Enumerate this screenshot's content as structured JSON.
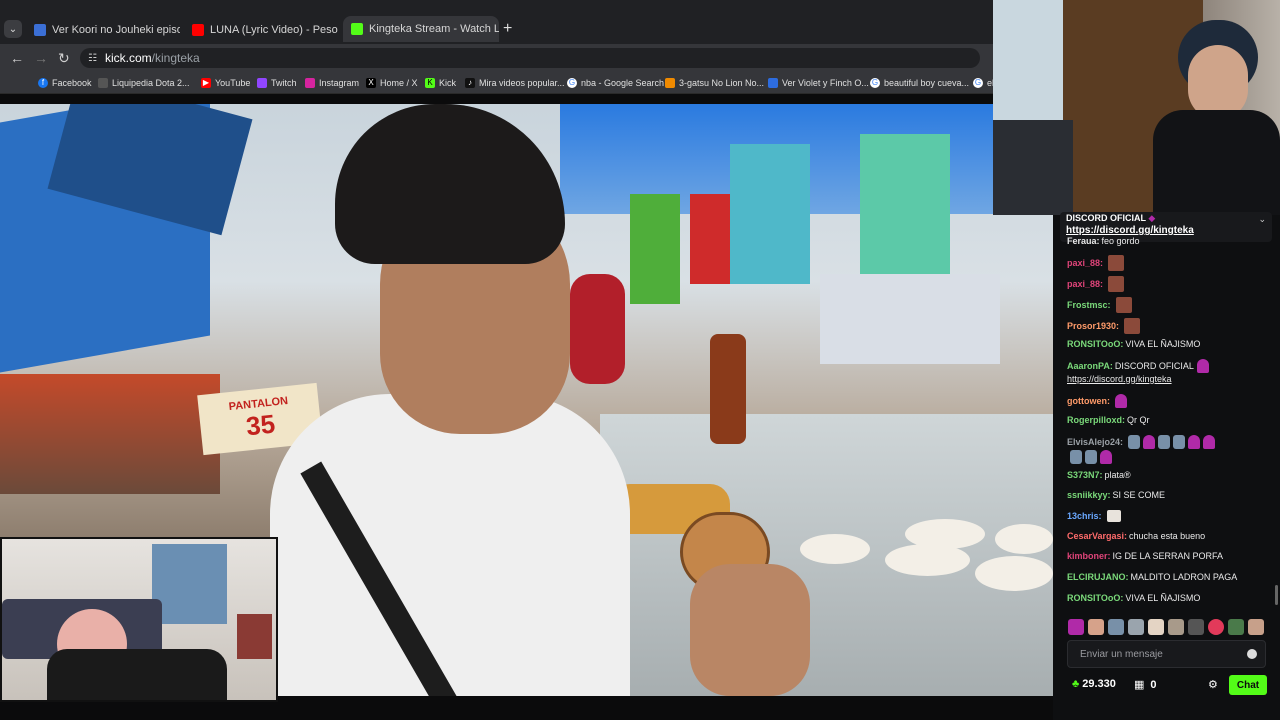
{
  "browser": {
    "tabs": [
      {
        "title": "Ver Koori no Jouheki episodio",
        "favicon_color": "#3b6fd6"
      },
      {
        "title": "LUNA (Lyric Video) - Peso Plum",
        "favicon_color": "#ff0000"
      },
      {
        "title": "Kingteka Stream - Watch Li",
        "favicon_color": "#53fc18",
        "active": true
      }
    ],
    "url_host": "kick.com",
    "url_path": "/kingteka",
    "bookmarks": [
      {
        "label": "Facebook",
        "color": "#1877f2"
      },
      {
        "label": "Liquipedia Dota 2...",
        "color": "#555555"
      },
      {
        "label": "YouTube",
        "color": "#ff0000"
      },
      {
        "label": "Twitch",
        "color": "#9146ff"
      },
      {
        "label": "Instagram",
        "color": "#d6249f"
      },
      {
        "label": "Home / X",
        "color": "#000000"
      },
      {
        "label": "Kick",
        "color": "#53fc18"
      },
      {
        "label": "Mira videos popular...",
        "color": "#111111"
      },
      {
        "label": "nba - Google Search",
        "color": "#4285f4"
      },
      {
        "label": "3-gatsu No Lion No...",
        "color": "#f08a00"
      },
      {
        "label": "Ver Violet y Finch O...",
        "color": "#2d6cdf"
      },
      {
        "label": "beautiful boy cueva...",
        "color": "#4285f4"
      },
      {
        "label": "el",
        "color": "#4285f4"
      }
    ]
  },
  "video": {
    "sign_text_1": "PANTALON",
    "sign_text_2": "35"
  },
  "chat": {
    "pinned_title": "DISCORD OFICIAL",
    "pinned_link": "https://discord.gg/kingteka",
    "messages": [
      {
        "user": "Feraua:",
        "color": "#e8e8e8",
        "text": "feo gordo",
        "emotes": []
      },
      {
        "user": "paxi_88:",
        "color": "#e0447a",
        "text": "",
        "emotes": [
          "sq"
        ]
      },
      {
        "user": "paxi_88:",
        "color": "#e0447a",
        "text": "",
        "emotes": [
          "sq"
        ]
      },
      {
        "user": "Frostmsc:",
        "color": "#7ad97a",
        "text": "",
        "emotes": [
          "sq"
        ]
      },
      {
        "user": "Prosor1930:",
        "color": "#ff9b6a",
        "text": "",
        "emotes": [
          "sq"
        ]
      },
      {
        "user": "RONSITOoO:",
        "color": "#7ad97a",
        "text": "VIVA EL ÑAJISMO",
        "emotes": []
      },
      {
        "user": "AaaronPA:",
        "color": "#7ad97a",
        "text": "DISCORD OFICIAL",
        "emotes": [
          "ft"
        ]
      },
      {
        "user": "",
        "color": "#e8e8e8",
        "text": "https://discord.gg/kingteka",
        "emotes": []
      },
      {
        "user": "gottowen:",
        "color": "#ff9b6a",
        "text": "",
        "emotes": [
          "ft"
        ]
      },
      {
        "user": "Rogerpilloxd:",
        "color": "#7ad97a",
        "text": "Qr Qr",
        "emotes": []
      },
      {
        "user": "ElvisAlejo24:",
        "color": "#9aa0a6",
        "text": "",
        "emotes": [
          "bt",
          "ft",
          "bt",
          "bt",
          "ft",
          "ft"
        ]
      },
      {
        "user": "",
        "color": "#9aa0a6",
        "text": "",
        "emotes": [
          "bt",
          "bt",
          "ft"
        ]
      },
      {
        "user": "S373N7:",
        "color": "#7ad97a",
        "text": "plata®",
        "emotes": []
      },
      {
        "user": "ssniikkyy:",
        "color": "#7ad97a",
        "text": "SI SE COME",
        "emotes": []
      },
      {
        "user": "13chris:",
        "color": "#6aa8ff",
        "text": "",
        "emotes": [
          "pg"
        ]
      },
      {
        "user": "CesarVargasi:",
        "color": "#ff6b6b",
        "text": "chucha esta bueno",
        "emotes": []
      },
      {
        "user": "kimboner:",
        "color": "#e0447a",
        "text": "IG DE LA SERRAN PORFA",
        "emotes": []
      },
      {
        "user": "ELCIRUJANO:",
        "color": "#7ad97a",
        "text": "MALDITO LADRON PAGA",
        "emotes": []
      },
      {
        "user": "RONSITOoO:",
        "color": "#7ad97a",
        "text": "VIVA EL ÑAJISMO",
        "emotes": []
      }
    ],
    "input_placeholder": "Enviar un mensaje",
    "viewers": "29.330",
    "gifts": "0",
    "chat_button": "Chat",
    "accent": "#53fc18"
  }
}
